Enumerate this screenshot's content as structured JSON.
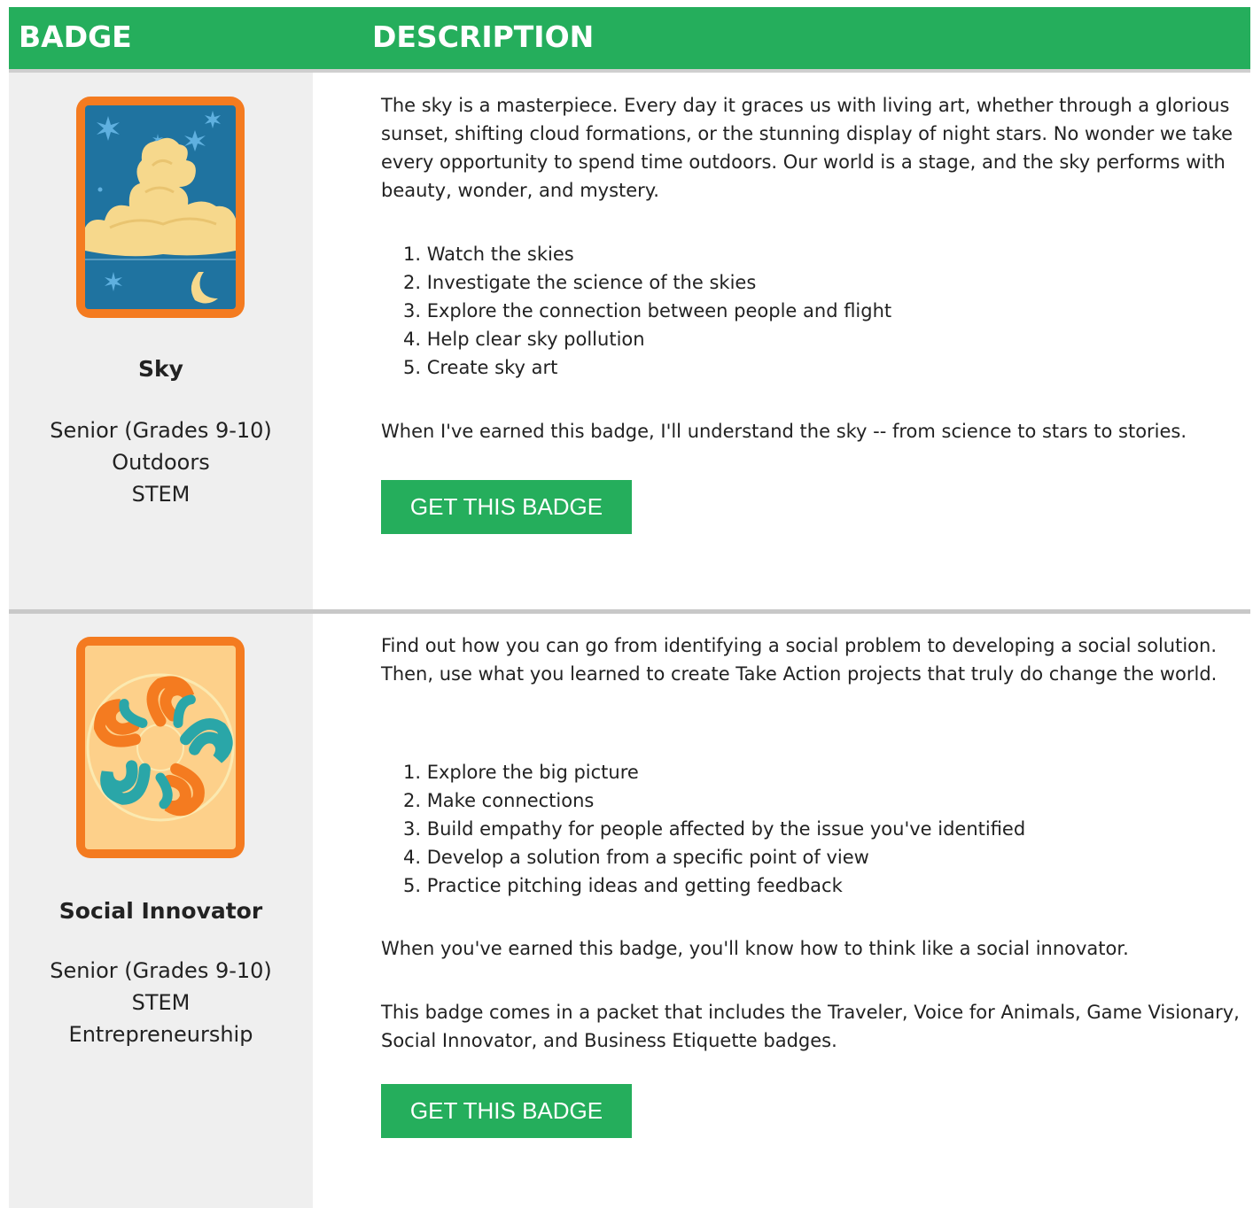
{
  "header": {
    "badge_col": "BADGE",
    "description_col": "DESCRIPTION"
  },
  "colors": {
    "brand_green": "#25ae5c",
    "badge_cell_bg": "#efefef",
    "badge_orange": "#f47b20",
    "sky_blue": "#1f73a0",
    "cloud_yellow": "#f6d88c"
  },
  "badges": [
    {
      "name": "Sky",
      "icon": "sky-badge-icon",
      "level": "Senior (Grades 9-10)",
      "categories": [
        "Outdoors",
        "STEM"
      ],
      "intro": "The sky is a masterpiece. Every day it graces us with living art, whether through a glorious sunset, shifting cloud formations, or the stunning display of night stars. No wonder we take every opportunity to spend time outdoors. Our world is a stage, and the sky performs with beauty, wonder, and mystery.",
      "steps": [
        {
          "num": "1.",
          "text": "Watch the skies"
        },
        {
          "num": "2.",
          "text": "Investigate the science of the skies"
        },
        {
          "num": "3.",
          "text": "Explore the connection between people and flight"
        },
        {
          "num": "4.",
          "text": "Help clear sky pollution"
        },
        {
          "num": "5.",
          "text": "Create sky art"
        }
      ],
      "outcome": "When I've earned this badge, I'll understand the sky -- from science to stars to stories.",
      "button_label": "GET THIS BADGE"
    },
    {
      "name": "Social Innovator",
      "icon": "social-innovator-badge-icon",
      "level": "Senior (Grades 9-10)",
      "categories": [
        "STEM",
        "Entrepreneurship"
      ],
      "intro": "Find out how you can go from identifying a social problem to developing a social solution. Then, use what you learned to create Take Action projects that truly do change the world.",
      "steps": [
        {
          "num": "1.",
          "text": "Explore the big picture"
        },
        {
          "num": "2.",
          "text": "Make connections"
        },
        {
          "num": "3.",
          "text": "Build empathy for people affected by the issue you've identified"
        },
        {
          "num": "4.",
          "text": "Develop a solution from a specific point of view"
        },
        {
          "num": "5.",
          "text": "Practice pitching ideas and getting feedback"
        }
      ],
      "outcome": "When you've earned this badge, you'll know how to think like a social innovator.",
      "packet_note": "This badge comes in a packet that includes the Traveler, Voice for Animals, Game Visionary, Social Innovator, and Business Etiquette badges.",
      "button_label": "GET THIS BADGE"
    }
  ]
}
